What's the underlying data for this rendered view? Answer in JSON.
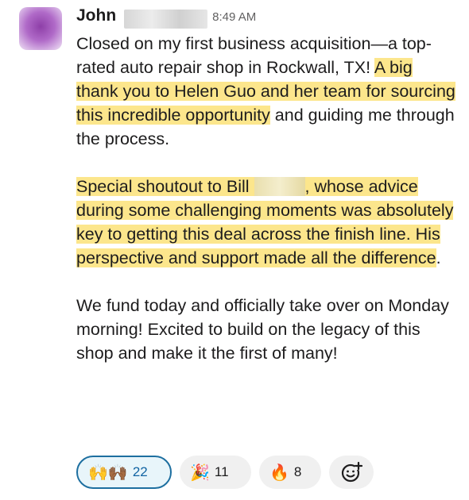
{
  "message": {
    "author": "John",
    "time": "8:49 AM",
    "p1_a": "Closed on my first business acquisition—a top-rated auto repair shop in Rockwall, TX! ",
    "p1_hl": "A big thank you to Helen Guo and her team for sourcing this incredible opportunity",
    "p1_b": " and guiding me through the process.",
    "p2_a": "Special shoutout to Bill ",
    "p2_b": ", whose advice during some challenging moments was absolutely key to getting this deal across the finish line. His perspective and support made all the difference",
    "p2_c": ".",
    "p3": "We fund today and officially take over on Monday morning! Excited to build on the legacy of this shop and make it the first of many!"
  },
  "reactions": [
    {
      "icon": "raised-hands",
      "glyph": "🙌🙌🏾",
      "count": "22",
      "active": true
    },
    {
      "icon": "party-popper",
      "glyph": "🎉",
      "count": "11",
      "active": false
    },
    {
      "icon": "fire",
      "glyph": "🔥",
      "count": "8",
      "active": false
    }
  ]
}
